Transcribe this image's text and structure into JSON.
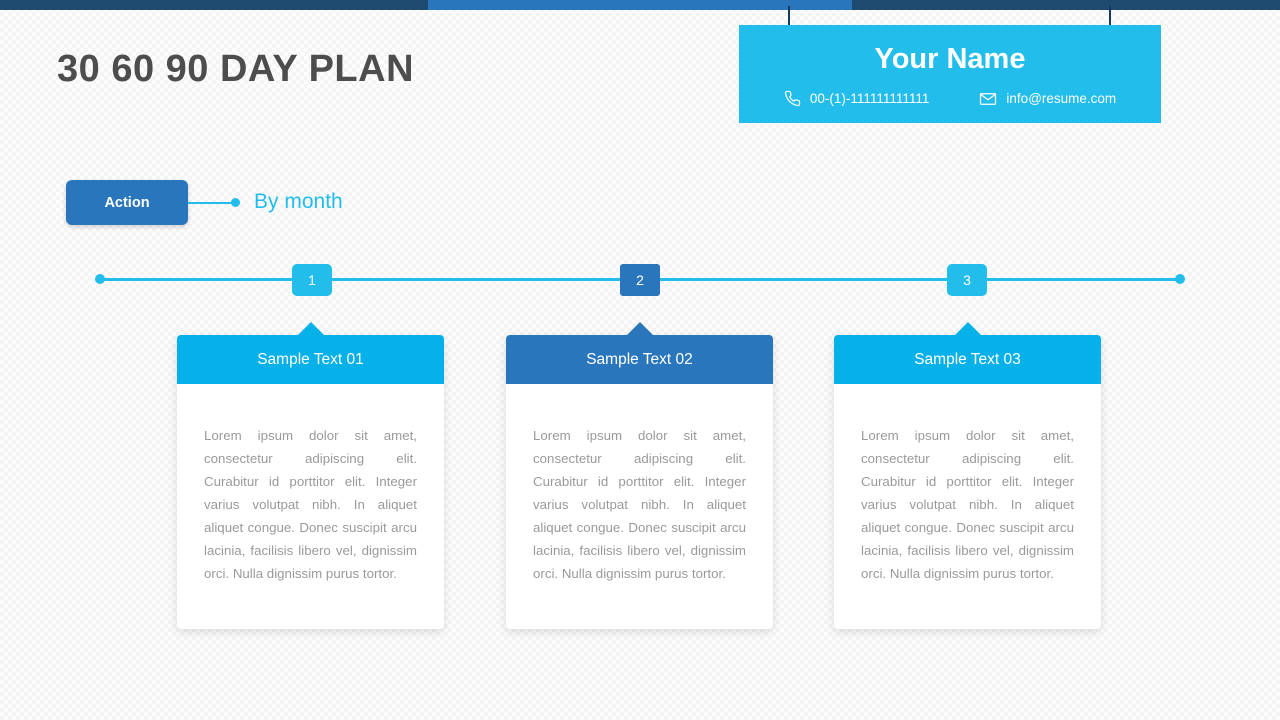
{
  "topbar": {
    "dark_color": "#1f4a70",
    "light_color": "#2a76bd"
  },
  "header": {
    "title": "30 60 90 DAY PLAN"
  },
  "name_card": {
    "name": "Your Name",
    "background_color": "#22bdeb",
    "phone": "00-(1)-111111111111",
    "email": "info@resume.com",
    "phone_icon": "phone-icon",
    "email_icon": "envelope-icon"
  },
  "legend": {
    "action_label": "Action",
    "action_color": "#2a76bd",
    "by_month_label": "By month",
    "by_month_color": "#22bdeb"
  },
  "timeline": {
    "line_color": "#22bdeb",
    "steps": [
      {
        "number": "1",
        "color": "#22bdeb"
      },
      {
        "number": "2",
        "color": "#2a76bd"
      },
      {
        "number": "3",
        "color": "#22bdeb"
      }
    ]
  },
  "cards": [
    {
      "title": "Sample Text 01",
      "header_color": "#06b0e8",
      "body": "Lorem ipsum dolor sit amet, consectetur adipiscing elit. Curabitur id porttitor elit. Integer varius volutpat nibh. In aliquet aliquet congue. Donec suscipit arcu lacinia, facilisis libero vel, dignissim orci. Nulla dignissim purus tortor."
    },
    {
      "title": "Sample Text 02",
      "header_color": "#2a76bd",
      "body": "Lorem ipsum dolor sit amet, consectetur adipiscing elit. Curabitur id porttitor elit. Integer varius volutpat nibh. In aliquet aliquet congue. Donec suscipit arcu lacinia, facilisis libero vel, dignissim orci. Nulla dignissim purus tortor."
    },
    {
      "title": "Sample Text 03",
      "header_color": "#06b0e8",
      "body": "Lorem ipsum dolor sit amet, consectetur adipiscing elit. Curabitur id porttitor elit. Integer varius volutpat nibh. In aliquet aliquet congue. Donec suscipit arcu lacinia, facilisis libero vel, dignissim orci. Nulla dignissim purus tortor."
    }
  ]
}
